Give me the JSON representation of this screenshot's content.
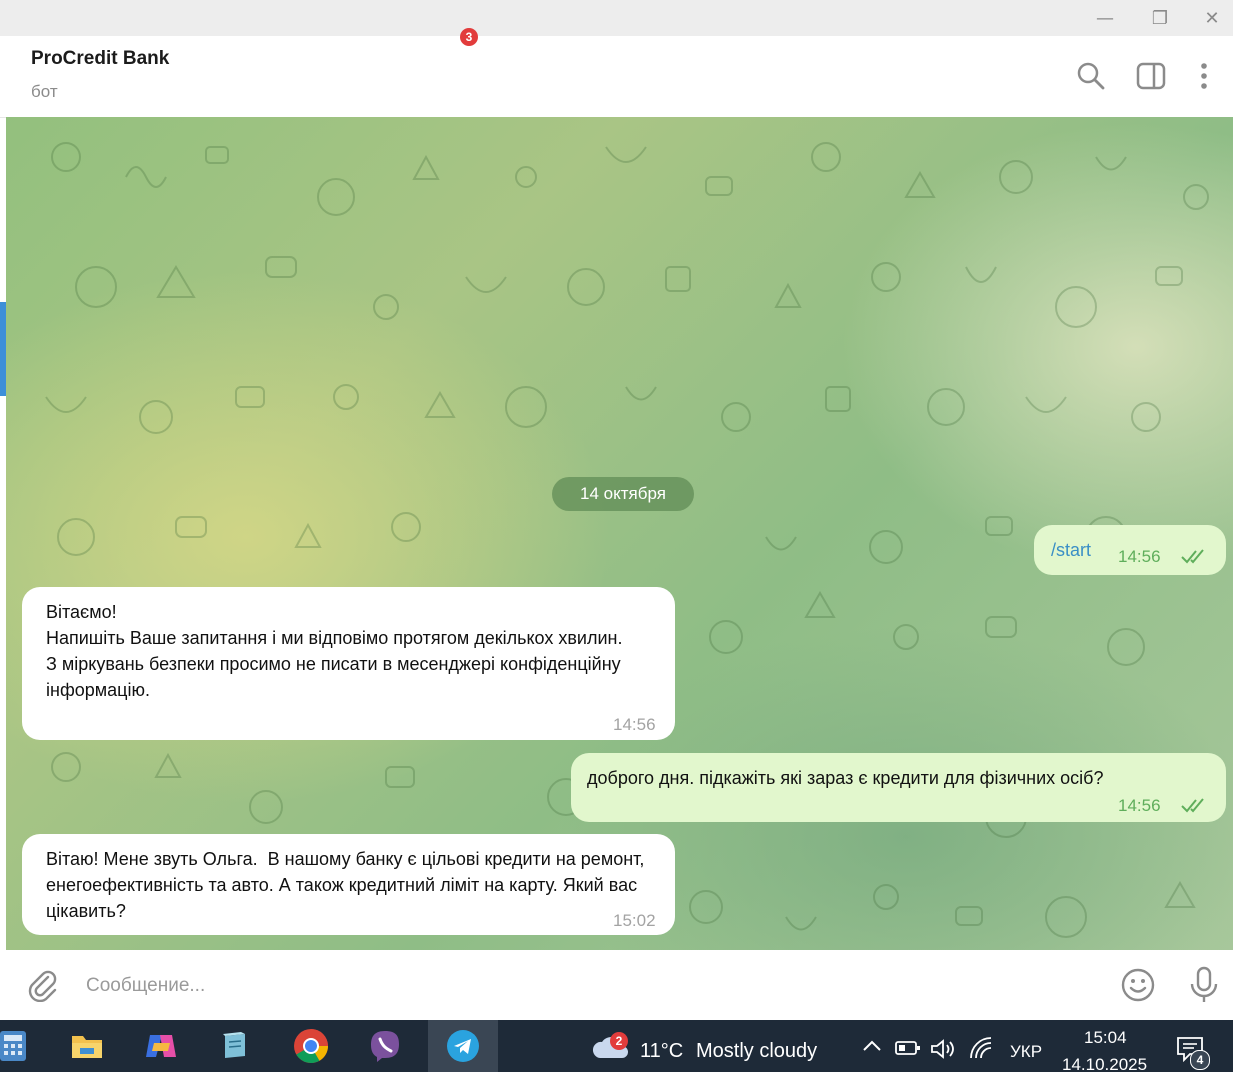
{
  "window": {
    "minimize_glyph": "—",
    "restore_glyph": "❐",
    "close_glyph": "✕"
  },
  "header": {
    "title": "ProCredit Bank",
    "subtitle": "бот",
    "icons": [
      "search-icon",
      "sidebar-toggle-icon",
      "more-vertical-icon"
    ]
  },
  "chat": {
    "date_separator": "14 октября",
    "messages": [
      {
        "direction": "out",
        "text": "/start",
        "time": "14:56",
        "status": "read"
      },
      {
        "direction": "in",
        "text": "Вітаємо!\nНапишіть Ваше запитання і ми відповімо протягом декількох хвилин.\nЗ міркувань безпеки просимо не писати в месенджері конфіденційну інформацію.",
        "time": "14:56"
      },
      {
        "direction": "out",
        "text": "доброго дня. підкажіть які зараз є кредити для фізичних осіб?",
        "time": "14:56",
        "status": "read"
      },
      {
        "direction": "in",
        "text": "Вітаю! Мене звуть Ольга.  В нашому банку є цільові кредити на ремонт, енегоефективність та авто. А також кредитний ліміт на карту. Який вас цікавить?",
        "time": "15:02"
      }
    ]
  },
  "composer": {
    "placeholder": "Сообщение...",
    "value": ""
  },
  "taskbar": {
    "apps": [
      "calculator-icon",
      "file-explorer-icon",
      "copilot-icon",
      "notepad-icon",
      "chrome-icon",
      "viber-icon",
      "telegram-icon"
    ],
    "telegram_badge": "3",
    "weather_badge": "2",
    "temperature": "11°C",
    "weather": "Mostly cloudy",
    "language": "УКР",
    "time": "15:04",
    "date": "14.10.2025",
    "notifications_count": "4"
  },
  "colors": {
    "accent": "#3d8fd9",
    "incoming_bubble": "#ffffff",
    "outgoing_bubble": "#e2f7cd",
    "read_check": "#5fae5b",
    "taskbar": "#1e2a38"
  }
}
